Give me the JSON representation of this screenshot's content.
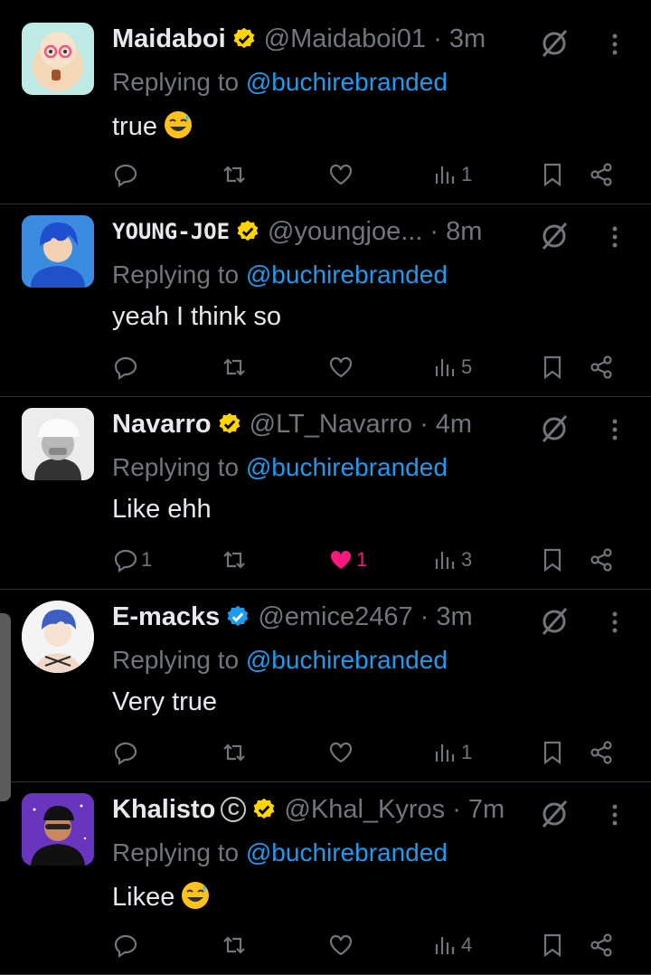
{
  "reply_prefix": "Replying to",
  "reply_target": "@buchirebranded",
  "colors": {
    "background": "#000000",
    "verified": "#ffd400",
    "verified_blue": "#1d9bf0",
    "mention": "#1d9bf0",
    "like_active": "#f91880",
    "muted": "#71767b"
  },
  "tweets": [
    {
      "name": "Maidaboi",
      "handle_time": "@Maidaboi01 · 3m",
      "badge": "gold-verified-icon",
      "text": "true",
      "emoji": "sweat-smile-emoji",
      "replies": "",
      "likes": "",
      "liked": false,
      "views": "1"
    },
    {
      "name": "YOUNG-JOE",
      "handle_time": "@youngjoe...  · 8m",
      "badge": "gold-verified-icon",
      "text": "yeah I think so",
      "emoji": "",
      "replies": "",
      "likes": "",
      "liked": false,
      "views": "5"
    },
    {
      "name": "Navarro",
      "handle_time": "@LT_Navarro · 4m",
      "badge": "gold-verified-icon",
      "text": "Like ehh",
      "emoji": "",
      "replies": "1",
      "likes": "1",
      "liked": true,
      "views": "3"
    },
    {
      "name": "E-macks",
      "handle_time": "@emice2467 · 3m",
      "badge": "blue-verified-icon",
      "text": "Very true",
      "emoji": "",
      "replies": "",
      "likes": "",
      "liked": false,
      "views": "1"
    },
    {
      "name": "Khalisto",
      "copyright": "C",
      "handle_time": "@Khal_Kyros · 7m",
      "badge": "gold-verified-icon",
      "text": "Likee",
      "emoji": "sweat-smile-emoji",
      "replies": "",
      "likes": "",
      "liked": false,
      "views": "4"
    }
  ]
}
